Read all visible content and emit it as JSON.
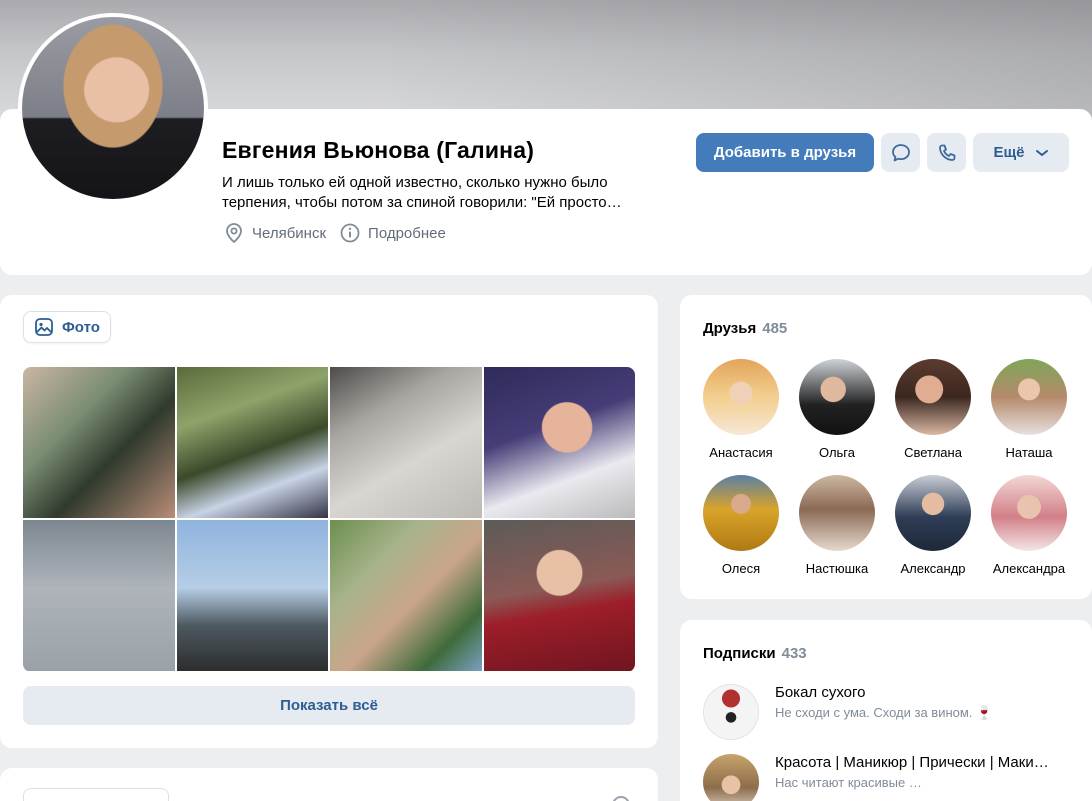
{
  "profile": {
    "name": "Евгения Вьюнова (Галина)",
    "status_line1": "И лишь только ей одной известно, сколько нужно было",
    "status_line2": "терпения, чтобы потом за спиной говорили: \"Ей просто…",
    "city": "Челябинск",
    "more_info": "Подробнее"
  },
  "actions": {
    "add_friend": "Добавить в друзья",
    "more": "Ещё"
  },
  "photos": {
    "tab_label": "Фото",
    "show_all": "Показать всё"
  },
  "friends": {
    "title": "Друзья",
    "count": "485",
    "items": [
      {
        "name": "Анастасия"
      },
      {
        "name": "Ольга"
      },
      {
        "name": "Светлана"
      },
      {
        "name": "Наташа"
      },
      {
        "name": "Олеся"
      },
      {
        "name": "Настюшка"
      },
      {
        "name": "Александр"
      },
      {
        "name": "Александра"
      }
    ]
  },
  "subscriptions": {
    "title": "Подписки",
    "count": "433",
    "items": [
      {
        "name": "Бокал сухого",
        "desc": "Не сходи с ума. Сходи за вином. 🍷"
      },
      {
        "name": "Красота | Маникюр | Прически | Маки…",
        "desc": "Нас читают красивые …"
      }
    ]
  },
  "colors": {
    "accent": "#447bba",
    "link": "#2c5d93",
    "secondary_bg": "#e5ebf1",
    "page_bg": "#edeef0",
    "muted_text": "#818c99"
  },
  "icons": {
    "message": "message-icon",
    "call": "phone-icon",
    "chevron": "chevron-down-icon",
    "location": "location-pin-icon",
    "info": "info-icon",
    "photo": "photo-icon"
  }
}
